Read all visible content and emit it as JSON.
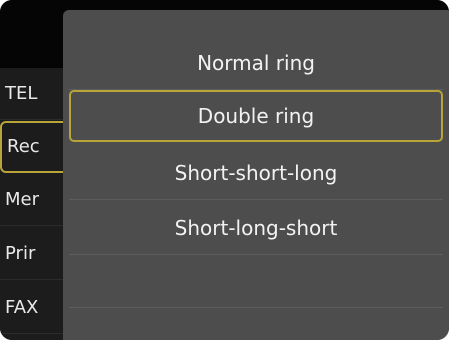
{
  "background_menu": {
    "items": [
      {
        "label": "TEL"
      },
      {
        "label": "Rec"
      },
      {
        "label": "Mer"
      },
      {
        "label": "Prir"
      },
      {
        "label": "FAX"
      }
    ],
    "selected_index": 1
  },
  "ring_pattern_list": {
    "options": [
      {
        "label": "Normal ring"
      },
      {
        "label": "Double ring"
      },
      {
        "label": "Short-short-long"
      },
      {
        "label": "Short-long-short"
      },
      {
        "label": ""
      }
    ],
    "selected_index": 1
  },
  "colors": {
    "highlight_border": "#b9a43a",
    "popup_background": "#4d4d4d",
    "screen_background": "#0d0d0d"
  }
}
